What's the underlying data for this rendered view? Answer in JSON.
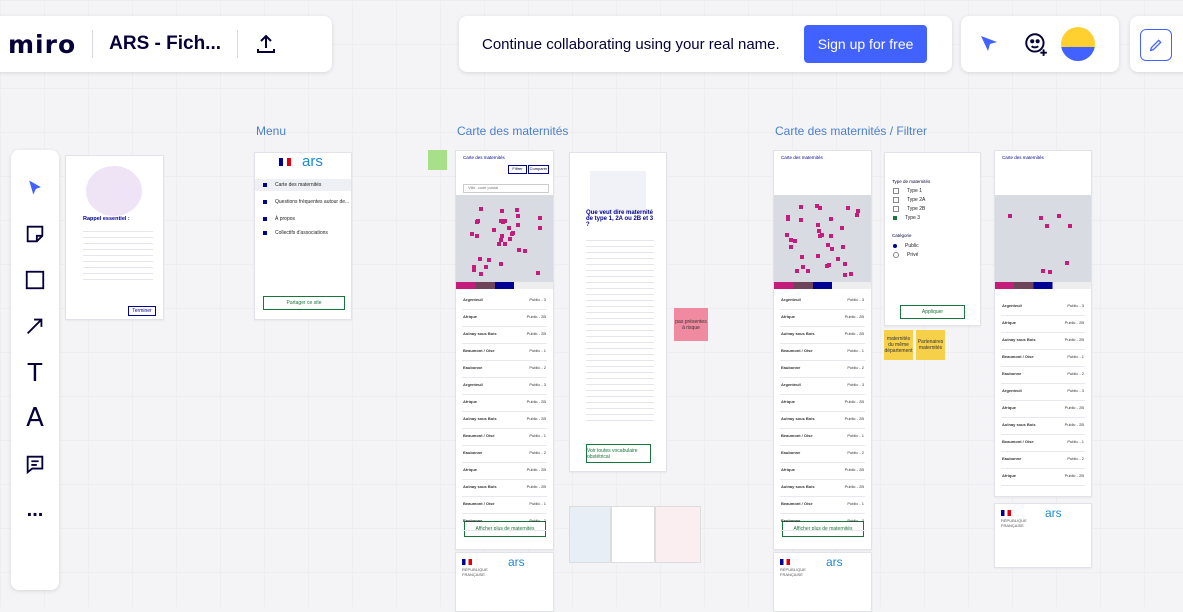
{
  "app": {
    "logo": "miro",
    "board_name": "ARS - Fich..."
  },
  "collab": {
    "message": "Continue collaborating using your real name.",
    "signup_label": "Sign up for free"
  },
  "icons": {
    "share": "upload-icon",
    "reactions": "cursor-icon",
    "invite": "face-plus-icon",
    "edit": "pencil-icon",
    "select": "arrow-pointer-icon",
    "sticky": "sticky-note-icon",
    "shape": "rectangle-icon",
    "line": "arrow-line-icon",
    "text": "text-icon",
    "pen": "pen-icon",
    "comment": "comment-icon",
    "more": "more-icon"
  },
  "toolbar": {
    "text_tool": "T",
    "pen_tool": "A",
    "more": "..."
  },
  "sections": {
    "menu": "Menu",
    "maternites": "Carte des maternités",
    "filtrer": "Carte des maternités / Filtrer"
  },
  "modal": {
    "title": "Rappel essentiel :",
    "next_label": "Terminer"
  },
  "menu_card": {
    "brand": "ars",
    "items": [
      "Carte des maternités",
      "Questions fréquentes autour de...",
      "À propos",
      "Collectifs d'associations"
    ],
    "share_label": "Partager ce site"
  },
  "map_card": {
    "header": "Carte des maternités",
    "tabs": [
      "Filtrer",
      "Comparer"
    ],
    "search_placeholder": "Ville, code postal",
    "list_rows": [
      {
        "name": "Argenteuil",
        "tag": "Public - 3"
      },
      {
        "name": "Afrique",
        "tag": "Public - 2B"
      },
      {
        "name": "Aulnay sous Bois",
        "tag": "Public - 2B"
      },
      {
        "name": "Beaumont / Oise",
        "tag": "Public - 1"
      },
      {
        "name": "Eaubonne",
        "tag": "Public - 2"
      },
      {
        "name": "Argenteuil",
        "tag": "Public - 3"
      },
      {
        "name": "Afrique",
        "tag": "Public - 2B"
      },
      {
        "name": "Aulnay sous Bois",
        "tag": "Public - 2B"
      },
      {
        "name": "Beaumont / Oise",
        "tag": "Public - 1"
      },
      {
        "name": "Eaubonne",
        "tag": "Public - 2"
      },
      {
        "name": "Afrique",
        "tag": "Public - 2B"
      },
      {
        "name": "Aulnay sous Bois",
        "tag": "Public - 2B"
      },
      {
        "name": "Beaumont / Oise",
        "tag": "Public - 1"
      },
      {
        "name": "Eaubonne",
        "tag": "Public - 2"
      }
    ],
    "more_label": "Afficher plus de maternités"
  },
  "info_card": {
    "title": "Que veut dire maternité de type 1, 2A ou 2B et 3 ?",
    "cta": "Voir toutes vocabulaire obstétrical"
  },
  "filter_card": {
    "title": "Type de maternités",
    "types": [
      "Type 1",
      "Type 2A",
      "Type 2B",
      "Type 3"
    ],
    "category_title": "Catégorie",
    "categories": [
      "Public",
      "Privé"
    ],
    "apply_label": "Appliquer"
  },
  "stickies": {
    "pink": "pas présentes à risque",
    "yellow1": "maternités du même département",
    "yellow2": "Partenaires maternités"
  },
  "footer": {
    "republic": "RÉPUBLIQUE FRANÇAISE",
    "brand": "ars"
  },
  "colors": {
    "accent": "#4262ff",
    "pin": "#c31d7c",
    "green": "#18753c",
    "navy": "#000091",
    "yellow_sticky": "#f7d04a",
    "pink_sticky": "#f08aa0",
    "green_sticky": "#a8e08a"
  }
}
